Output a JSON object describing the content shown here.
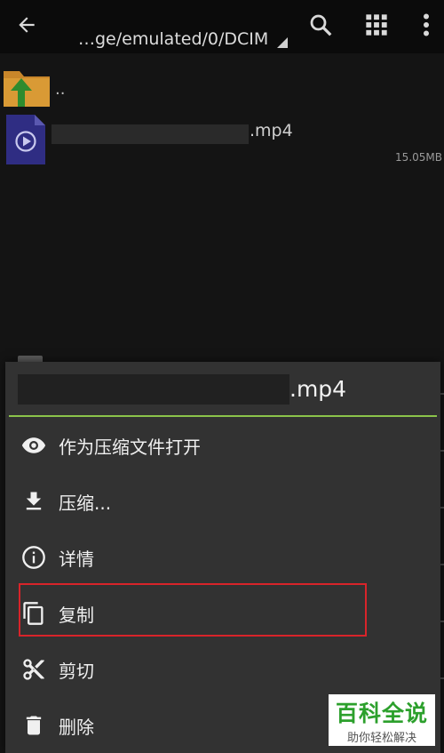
{
  "toolbar": {
    "path": "…ge/emulated/0/DCIM",
    "icons": [
      "back-arrow-icon",
      "search-icon",
      "grid-view-icon",
      "more-vert-icon"
    ]
  },
  "file_list": {
    "parent_label": "..",
    "files": [
      {
        "name_suffix": ".mp4",
        "size": "15.05MB"
      }
    ]
  },
  "context_menu": {
    "filename_suffix": ".mp4",
    "accent_color": "#8bc34a",
    "items": [
      {
        "icon": "eye-icon",
        "label": "作为压缩文件打开"
      },
      {
        "icon": "download-icon",
        "label": "压缩..."
      },
      {
        "icon": "info-icon",
        "label": "详情"
      },
      {
        "icon": "copy-icon",
        "label": "复制",
        "highlighted": true
      },
      {
        "icon": "scissors-icon",
        "label": "剪切"
      },
      {
        "icon": "trash-icon",
        "label": "删除"
      }
    ],
    "highlight_color": "#d8242a"
  },
  "watermark": {
    "title": "百科全说",
    "subtitle": "助你轻松解决"
  }
}
